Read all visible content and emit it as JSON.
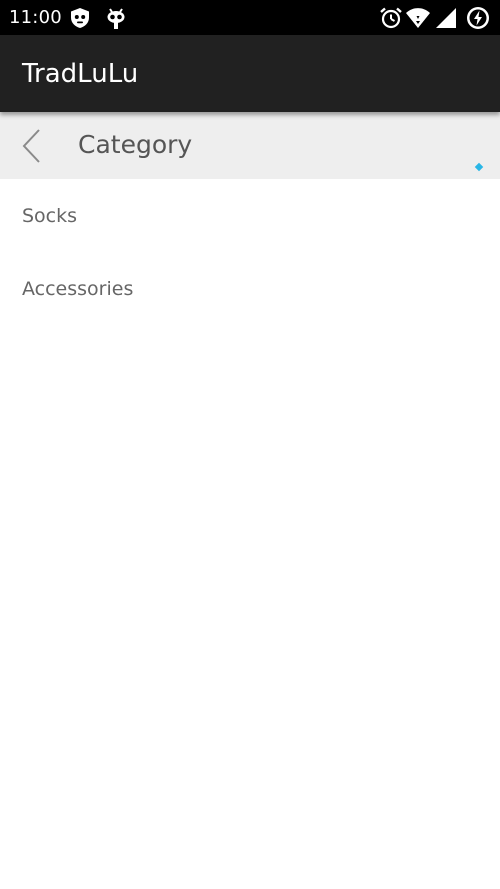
{
  "status_bar": {
    "time": "11:00",
    "left_icons": [
      "shield-face-icon",
      "bug-face-icon"
    ],
    "right_icons": [
      "alarm-clock-icon",
      "wifi-icon",
      "cell-signal-icon",
      "battery-charging-icon"
    ]
  },
  "app_bar": {
    "title": "TradLuLu",
    "background": "#212121"
  },
  "header": {
    "title": "Category",
    "back_icon": "chevron-left-icon",
    "background": "#eeeeee",
    "indicator_color": "#29b6e6"
  },
  "categories": [
    {
      "label": "Socks"
    },
    {
      "label": "Accessories"
    }
  ]
}
